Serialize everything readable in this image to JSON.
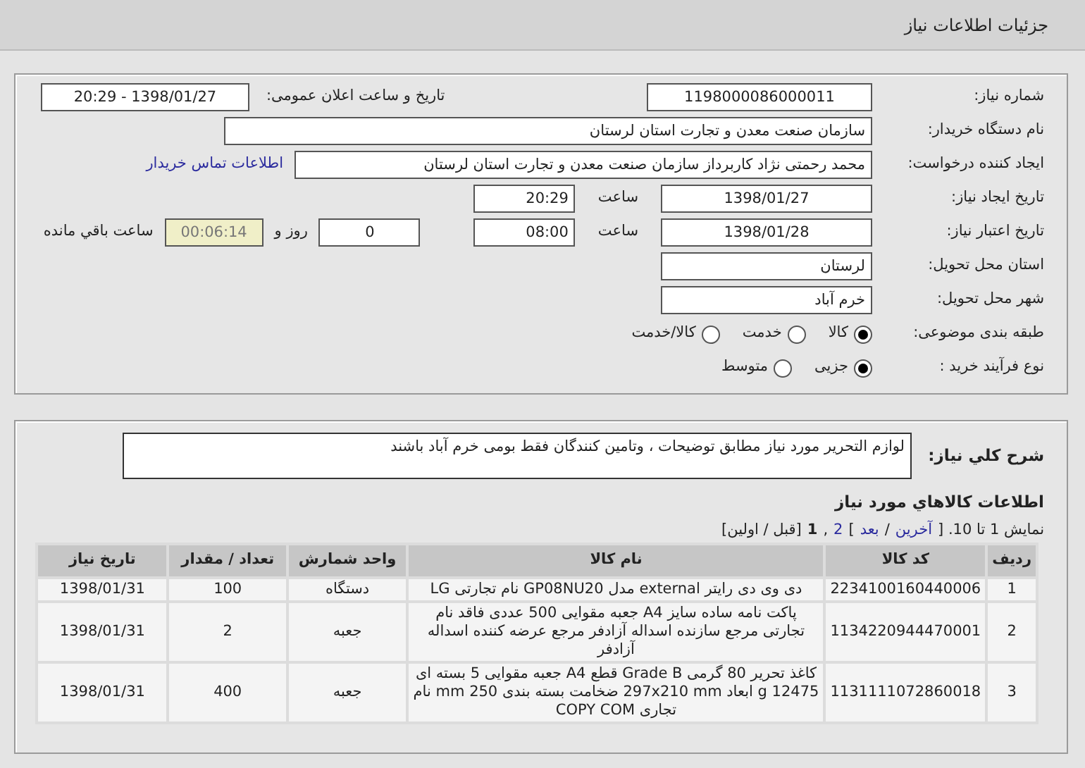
{
  "page_title": "جزئیات اطلاعات نیاز",
  "need_number": {
    "label": "شماره نیاز:",
    "value": "1198000086000011"
  },
  "announce": {
    "label": "تاریخ و ساعت اعلان عمومی:",
    "value": "1398/01/27 - 20:29"
  },
  "buyer": {
    "label": "نام دستگاه خریدار:",
    "value": "سازمان صنعت معدن و تجارت استان لرستان"
  },
  "requester": {
    "label": "ایجاد کننده درخواست:",
    "value": "محمد رحمتی نژاد کاربرداز سازمان صنعت معدن و تجارت استان لرستان",
    "link": "اطلاعات تماس خریدار"
  },
  "created": {
    "label": "تاریخ ایجاد نیاز:",
    "date": "1398/01/27",
    "time_label": "ساعت",
    "time": "20:29"
  },
  "validity": {
    "label": "تاریخ اعتبار نیاز:",
    "date": "1398/01/28",
    "time_label": "ساعت",
    "time": "08:00",
    "days": "0",
    "days_label": "روز و",
    "remaining": "00:06:14",
    "remaining_label": "ساعت باقي مانده"
  },
  "province": {
    "label": "استان محل تحویل:",
    "value": "لرستان"
  },
  "city": {
    "label": "شهر محل تحویل:",
    "value": "خرم آباد"
  },
  "category": {
    "label": "طبقه بندی موضوعی:",
    "options": [
      {
        "label": "کالا",
        "selected": true
      },
      {
        "label": "خدمت",
        "selected": false
      },
      {
        "label": "کالا/خدمت",
        "selected": false
      }
    ]
  },
  "process": {
    "label": "نوع فرآیند خرید :",
    "options": [
      {
        "label": "جزیی",
        "selected": true
      },
      {
        "label": "متوسط",
        "selected": false
      }
    ]
  },
  "description": {
    "label": "شرح کلي نياز:",
    "value": "لوازم التحریر مورد نیاز مطابق توضیحات ، وتامین کنندگان فقط بومی خرم آباد باشند"
  },
  "goods": {
    "title": "اطلاعات کالاهاي مورد نياز",
    "pagination": [
      {
        "kind": "text",
        "text": "نمایش 1 تا 10. ["
      },
      {
        "kind": "link",
        "text": "آخرین"
      },
      {
        "kind": "text",
        "text": "/"
      },
      {
        "kind": "link",
        "text": "بعد"
      },
      {
        "kind": "text",
        "text": "]"
      },
      {
        "kind": "link",
        "text": "2"
      },
      {
        "kind": "text",
        "text": ","
      },
      {
        "kind": "current",
        "text": "1"
      },
      {
        "kind": "text",
        "text": "[قبل / اولین]"
      }
    ],
    "columns": [
      "ردیف",
      "کد کالا",
      "نام کالا",
      "واحد شمارش",
      "تعداد / مقدار",
      "تاریخ نیاز"
    ],
    "rows": [
      [
        "1",
        "2234100160440006",
        "دی وی دی رایتر external مدل GP08NU20 نام تجارتی LG",
        "دستگاه",
        "100",
        "1398/01/31"
      ],
      [
        "2",
        "1134220944470001",
        "پاکت نامه ساده سایز A4 جعبه مقوایی 500 عددی فاقد نام تجارتی مرجع سازنده اسداله آزادفر مرجع عرضه کننده اسداله آزادفر",
        "جعبه",
        "2",
        "1398/01/31"
      ],
      [
        "3",
        "1131111072860018",
        "کاغذ تحریر 80 گرمی Grade B قطع A4 جعبه مقوایی 5 بسته ای 12475 g ابعاد 297x210 mm ضخامت بسته بندی 250 mm نام تجاری COPY COM",
        "جعبه",
        "400",
        "1398/01/31"
      ]
    ]
  }
}
